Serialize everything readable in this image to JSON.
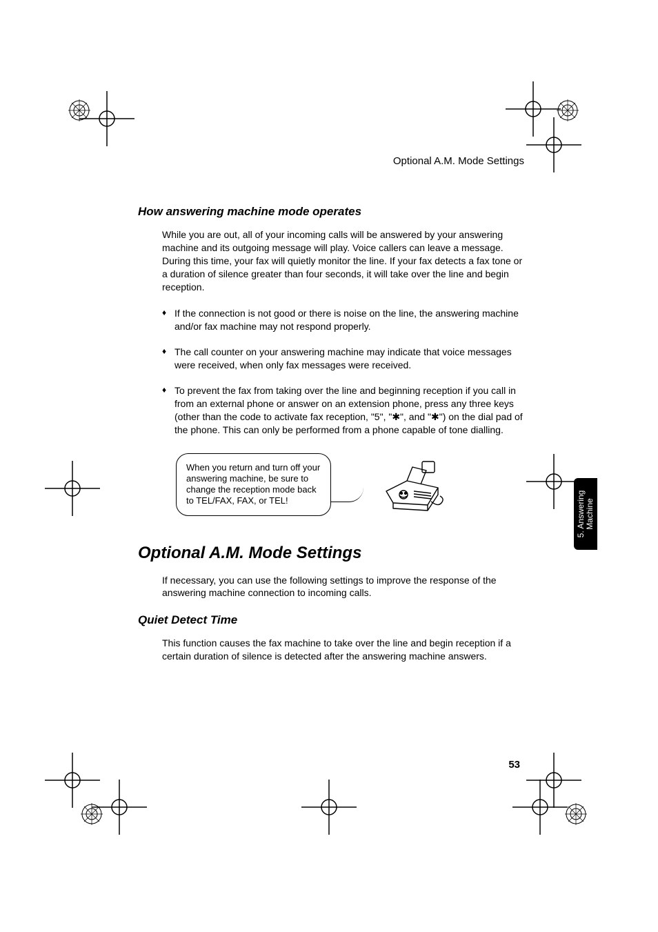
{
  "running_head": "Optional A.M. Mode Settings",
  "section1": {
    "heading": "How answering machine mode operates",
    "intro": "While you are out, all of your incoming calls will be answered by your answering machine and its outgoing message will play. Voice callers can leave a message. During this time, your fax will quietly monitor the line. If your fax detects a fax tone or a duration of silence greater than four seconds, it will take over the line and begin reception.",
    "bullets": [
      "If the connection is not good or there is noise on the line, the answering machine and/or fax machine may not respond properly.",
      "The call counter on your answering machine may indicate that voice messages were received, when only fax messages were received.",
      "To prevent the fax from taking over the line and beginning reception if you call in from an external phone or answer on an extension phone, press any three keys (other than the code to activate fax reception, \"5\", \"✱\", and \"✱\") on the dial pad of the phone. This can only be performed from a phone capable of tone dialling."
    ],
    "bubble": "When you return and turn off your answering machine, be sure to change the reception mode back to TEL/FAX, FAX, or TEL!"
  },
  "section2": {
    "heading": "Optional A.M. Mode Settings",
    "intro": "If necessary, you can use the following settings to improve the response of the answering machine connection to incoming calls.",
    "sub_heading": "Quiet Detect Time",
    "sub_para": "This function causes the fax machine to take over the line and begin reception if a certain duration of silence is detected after the answering machine answers."
  },
  "side_tab": "5. Answering\nMachine",
  "page_number": "53"
}
